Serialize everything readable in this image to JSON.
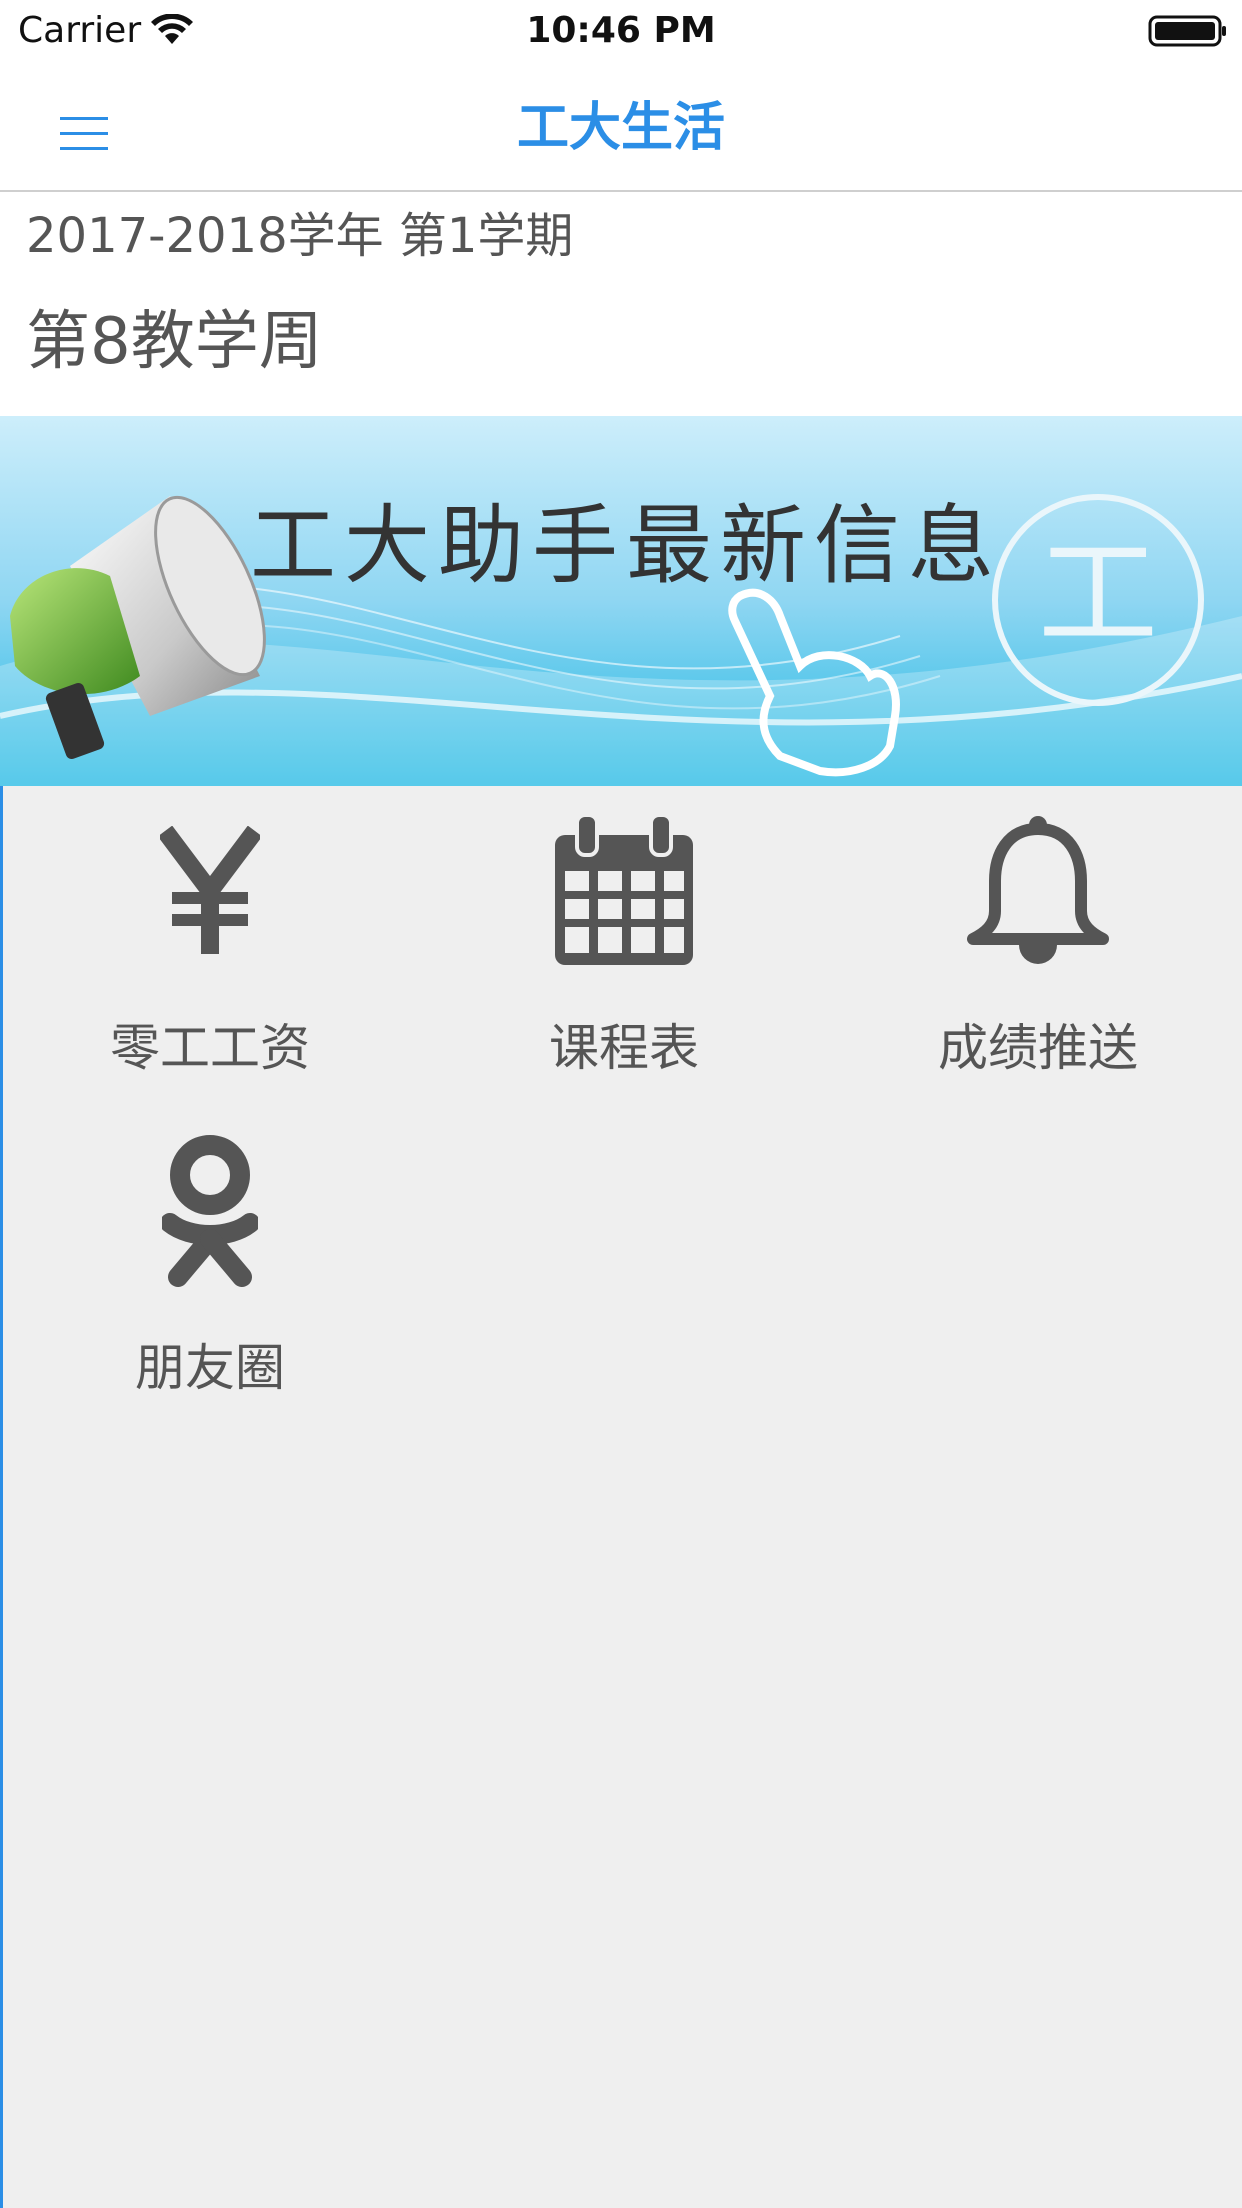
{
  "status_bar": {
    "carrier": "Carrier",
    "time": "10:46 PM"
  },
  "nav": {
    "title": "工大生活",
    "menu_icon": "hamburger-icon"
  },
  "term": {
    "semester": "2017-2018学年  第1学期",
    "week": "第8教学周"
  },
  "banner": {
    "caption": "工大助手最新信息",
    "badge_glyph": "工"
  },
  "grid": {
    "items": [
      {
        "label": "零工工资",
        "icon": "yen-icon"
      },
      {
        "label": "课程表",
        "icon": "calendar-icon"
      },
      {
        "label": "成绩推送",
        "icon": "bell-icon"
      },
      {
        "label": "朋友圈",
        "icon": "odnoklassniki-icon"
      }
    ]
  },
  "colors": {
    "accent": "#2b8ee6",
    "icon": "#555555",
    "background": "#efefef"
  }
}
